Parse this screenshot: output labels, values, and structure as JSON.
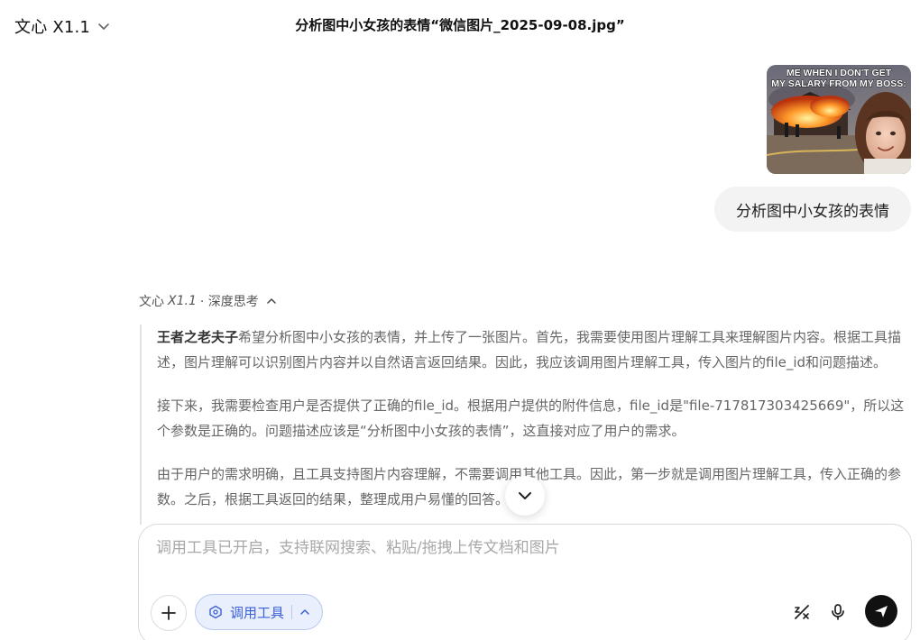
{
  "header": {
    "model_name": "文心 X1.1",
    "title": "分析图中小女孩的表情“微信图片_2025-09-08.jpg”"
  },
  "user_message": {
    "image_caption": "ME WHEN I DON'T GET MY SALARY FROM MY BOSS:",
    "text": "分析图中小女孩的表情"
  },
  "ai_response": {
    "model_prefix": "文心",
    "model_version": "X1.1",
    "mode_label": "· 深度思考",
    "thinking": {
      "p1_bold": "王者之老夫子",
      "p1_rest": "希望分析图中小女孩的表情，并上传了一张图片。首先，我需要使用图片理解工具来理解图片内容。根据工具描述，图片理解可以识别图片内容并以自然语言返回结果。因此，我应该调用图片理解工具，传入图片的file_id和问题描述。",
      "p2": "接下来，我需要检查用户是否提供了正确的file_id。根据用户提供的附件信息，file_id是\"file-717817303425669\"，所以这个参数是正确的。问题描述应该是“分析图中小女孩的表情”，这直接对应了用户的需求。",
      "p3": "由于用户的需求明确，且工具支持图片内容理解，不需要调用其他工具。因此，第一步就是调用图片理解工具，传入正确的参数。之后，根据工具返回的结果，整理成用户易懂的回答。"
    }
  },
  "composer": {
    "placeholder": "调用工具已开启，支持联网搜索、粘贴/拖拽上传文档和图片",
    "value": "",
    "tool_label": "调用工具"
  },
  "colors": {
    "accent": "#3a5fd6",
    "pill_bg": "#e9effd",
    "send_bg": "#111111"
  }
}
